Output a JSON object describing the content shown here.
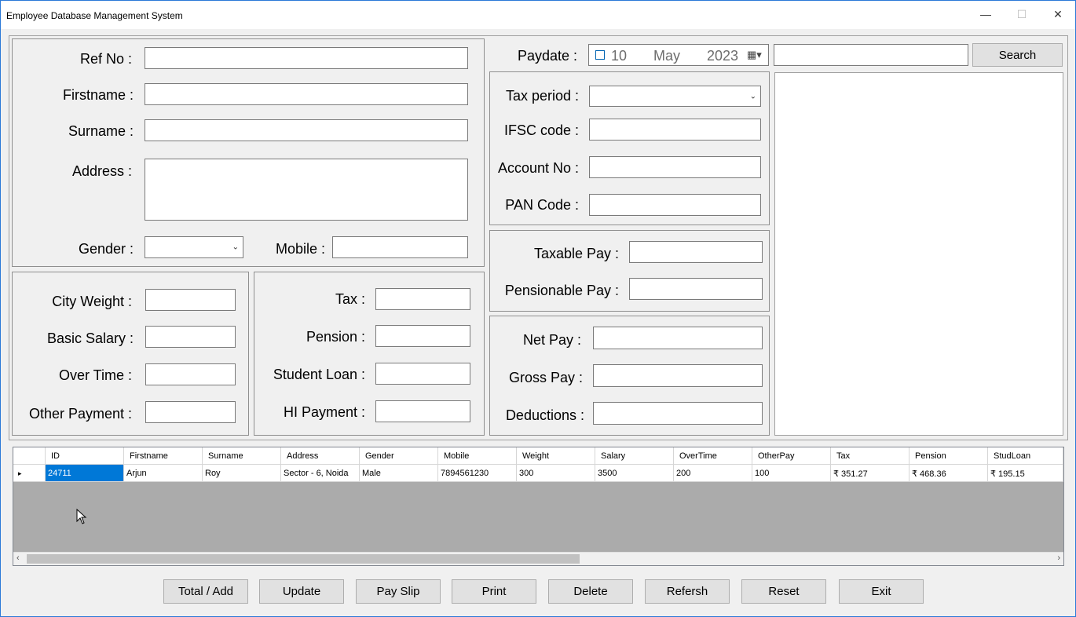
{
  "window": {
    "title": "Employee Database Management System",
    "minimize_glyph": "—",
    "maximize_glyph": "☐",
    "close_glyph": "✕"
  },
  "personal": {
    "ref_no_label": "Ref No :",
    "firstname_label": "Firstname :",
    "surname_label": "Surname :",
    "address_label": "Address :",
    "gender_label": "Gender :",
    "mobile_label": "Mobile :"
  },
  "salary": {
    "city_weight_label": "City Weight :",
    "basic_salary_label": "Basic Salary :",
    "over_time_label": "Over Time :",
    "other_payment_label": "Other Payment :"
  },
  "deductions_box": {
    "tax_label": "Tax :",
    "pension_label": "Pension :",
    "student_loan_label": "Student Loan :",
    "hi_payment_label": "HI Payment :"
  },
  "paydate": {
    "label": "Paydate :",
    "day": "10",
    "month": "May",
    "year": "2023"
  },
  "search": {
    "button": "Search"
  },
  "bank": {
    "tax_period_label": "Tax period :",
    "ifsc_label": "IFSC code :",
    "account_label": "Account No :",
    "pan_label": "PAN Code :"
  },
  "pay": {
    "taxable_label": "Taxable Pay :",
    "pensionable_label": "Pensionable Pay :",
    "net_label": "Net Pay :",
    "gross_label": "Gross Pay :",
    "deductions_label": "Deductions :"
  },
  "grid": {
    "columns": [
      "ID",
      "Firstname",
      "Surname",
      "Address",
      "Gender",
      "Mobile",
      "Weight",
      "Salary",
      "OverTime",
      "OtherPay",
      "Tax",
      "Pension",
      "StudLoan"
    ],
    "rows": [
      [
        "24711",
        "Arjun",
        "Roy",
        "Sector - 6, Noida",
        "Male",
        "7894561230",
        "300",
        "3500",
        "200",
        "100",
        "₹ 351.27",
        "₹ 468.36",
        "₹ 195.15"
      ]
    ]
  },
  "actions": {
    "total_add": "Total / Add",
    "update": "Update",
    "pay_slip": "Pay Slip",
    "print": "Print",
    "delete": "Delete",
    "refresh": "Refersh",
    "reset": "Reset",
    "exit": "Exit"
  }
}
